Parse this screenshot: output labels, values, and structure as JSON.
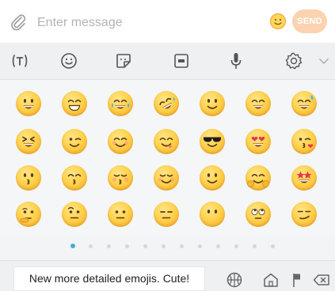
{
  "message_bar": {
    "placeholder": "Enter message",
    "send_label": "SEND",
    "attach_icon": "paperclip-icon",
    "emoji_toggle_icon": "smiley-icon"
  },
  "toolbar": {
    "items": [
      {
        "icon": "text-cursor-icon"
      },
      {
        "icon": "emoji-icon"
      },
      {
        "icon": "sticker-icon"
      },
      {
        "icon": "gif-icon"
      },
      {
        "icon": "microphone-icon"
      },
      {
        "icon": "settings-icon"
      },
      {
        "icon": "chevron-down-icon"
      }
    ]
  },
  "emoji_grid": {
    "rows": [
      [
        "grinning",
        "grin",
        "joy",
        "rofl",
        "slightly-smiling",
        "smile",
        "sweat-smile"
      ],
      [
        "laughing",
        "wink",
        "blush",
        "yum",
        "sunglasses",
        "heart-eyes",
        "kissing-heart"
      ],
      [
        "kissing",
        "kissing-smiling-eyes",
        "kissing-closed-eyes",
        "relaxed",
        "slightly-smiling",
        "hugging",
        "star-struck"
      ],
      [
        "thinking",
        "face-with-raised-eyebrow",
        "neutral",
        "expressionless",
        "no-mouth",
        "rolling-eyes",
        "smirk"
      ]
    ]
  },
  "pagination": {
    "total": 12,
    "active": 0
  },
  "caption": "New more detailed emojis. Cute!",
  "bottom_bar": {
    "icons": [
      "sports-ball-icon",
      "home-icon",
      "flag-icon",
      "backspace-icon"
    ]
  },
  "colors": {
    "accent_dot": "#4aa9d8",
    "send_button": "#fbd3b0",
    "emoji_yellow": "#ffd24d"
  }
}
